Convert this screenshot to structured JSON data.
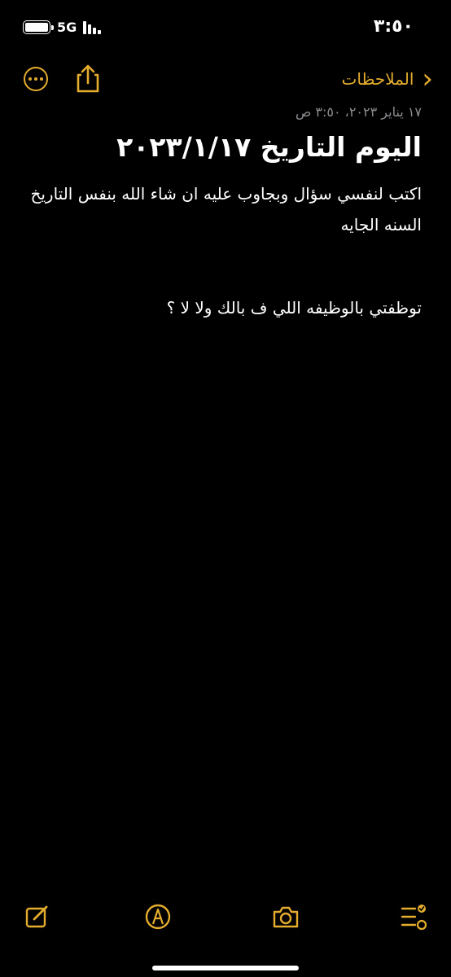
{
  "status_bar": {
    "time": "٣:٥٠",
    "network": "5G"
  },
  "nav": {
    "back_label": "الملاحظات"
  },
  "note": {
    "date": "١٧ يناير ٢٠٢٣، ٣:٥٠ ص",
    "title": "اليوم التاريخ ٢٠٢٣/١/١٧",
    "paragraph": "اكتب لنفسي سؤال وبجاوب عليه ان شاء الله بنفس التاريخ السنه الجايه",
    "question": "توظفتي بالوظيفه اللي ف بالك ولا لا ؟"
  },
  "colors": {
    "accent": "#e5ad2d",
    "background": "#000000",
    "secondary_text": "#8e8e93"
  },
  "toolbar": {
    "icons": [
      "compose-icon",
      "camera-icon",
      "markup-icon",
      "checklist-icon"
    ]
  }
}
